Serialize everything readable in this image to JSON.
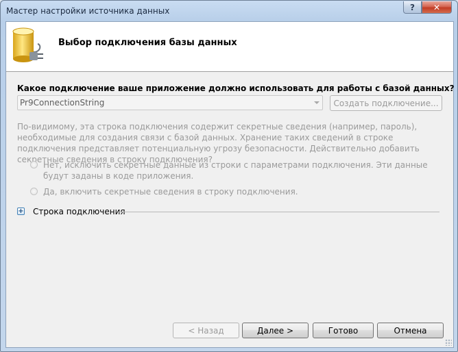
{
  "window": {
    "title": "Мастер настройки источника данных",
    "help_button": "?",
    "close_button": "✕"
  },
  "header": {
    "title": "Выбор подключения базы данных",
    "icon": "database-connection-icon"
  },
  "connection": {
    "question": "Какое подключение ваше приложение должно использовать для работы с базой данных?",
    "selected": "Pr9ConnectionString",
    "create_button": "Создать подключение..."
  },
  "sensitive": {
    "warning": "По-видимому, эта строка подключения содержит секретные сведения (например, пароль), необходимые для создания связи с базой данных. Хранение таких сведений в строке подключения представляет потенциальную угрозу безопасности. Действительно добавить секретные сведения в строку подключения?",
    "option_no": "Нет, исключить секретные данные из строки с параметрами подключения. Эти данные будут заданы в коде приложения.",
    "option_yes": "Да, включить секретные сведения в строку подключения."
  },
  "expander": {
    "label": "Строка подключения",
    "toggle": "+"
  },
  "footer": {
    "back": "< Назад",
    "next": "Далее >",
    "finish": "Готово",
    "cancel": "Отмена"
  }
}
